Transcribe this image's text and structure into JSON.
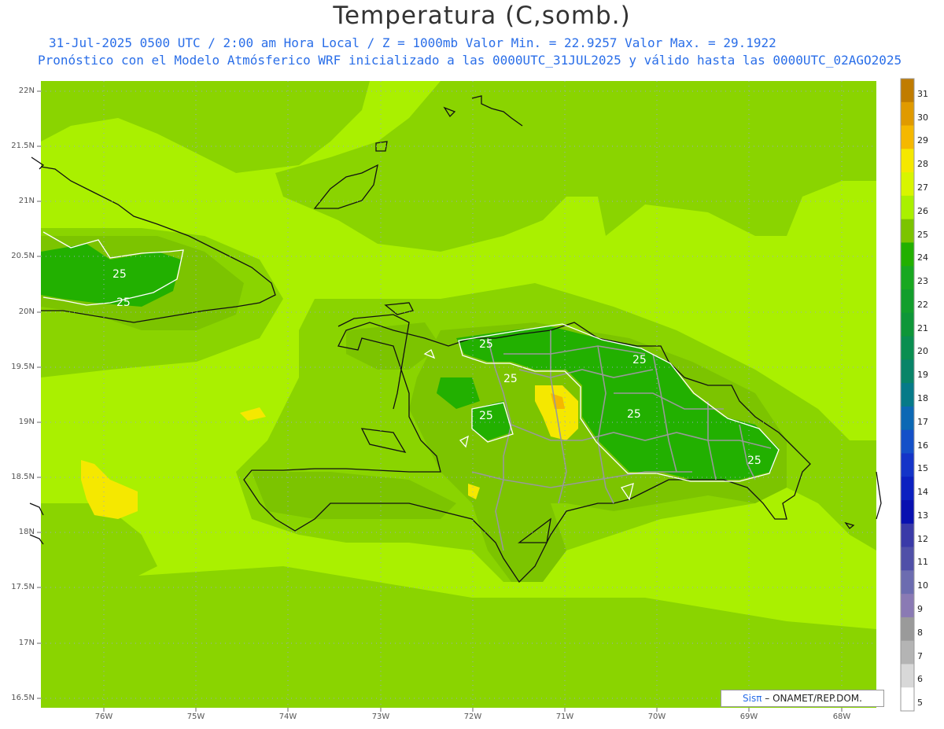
{
  "header": {
    "title": "Temperatura (C,somb.)",
    "line1": "31-Jul-2025  0500 UTC / 2:00 am Hora Local / Z = 1000mb   Valor Min. = 22.9257  Valor Max. = 29.1922",
    "line2": "Pronóstico con el Modelo Atmósferico WRF inicializado a las 0000UTC_31JUL2025 y válido hasta las  0000UTC_02AGO2025"
  },
  "axes": {
    "lat_labels": [
      "22N",
      "21.5N",
      "21N",
      "20.5N",
      "20N",
      "19.5N",
      "19N",
      "18.5N",
      "18N",
      "17.5N",
      "17N",
      "16.5N"
    ],
    "lon_labels": [
      "76W",
      "75W",
      "74W",
      "73W",
      "72W",
      "71W",
      "70W",
      "69W",
      "68W"
    ]
  },
  "colorbar": {
    "labels": [
      "31",
      "30",
      "29",
      "28",
      "27",
      "26",
      "25",
      "24",
      "23",
      "22",
      "21",
      "20",
      "19",
      "18",
      "17",
      "16",
      "15",
      "14",
      "13",
      "12",
      "11",
      "10",
      "9",
      "8",
      "7",
      "6",
      "5"
    ],
    "colors": [
      "#c07c00",
      "#e09a00",
      "#f5b800",
      "#f5e800",
      "#d8f500",
      "#aaf000",
      "#7cc400",
      "#22b000",
      "#18a820",
      "#129e2c",
      "#0e9638",
      "#0a8e50",
      "#088468",
      "#067a88",
      "#0c68b4",
      "#1450c8",
      "#1434c8",
      "#0c20c0",
      "#0810b0",
      "#3a3aa8",
      "#5050a8",
      "#6c6cb0",
      "#8a7ab4",
      "#9a9a9a",
      "#b4b4b4",
      "#d8d8d8",
      "#ffffff"
    ]
  },
  "contour_labels": [
    "25",
    "25",
    "25",
    "25",
    "25",
    "25",
    "25",
    "25"
  ],
  "credit": {
    "sis": "Sisπ",
    "rest": " – ONAMET/REP.DOM."
  }
}
